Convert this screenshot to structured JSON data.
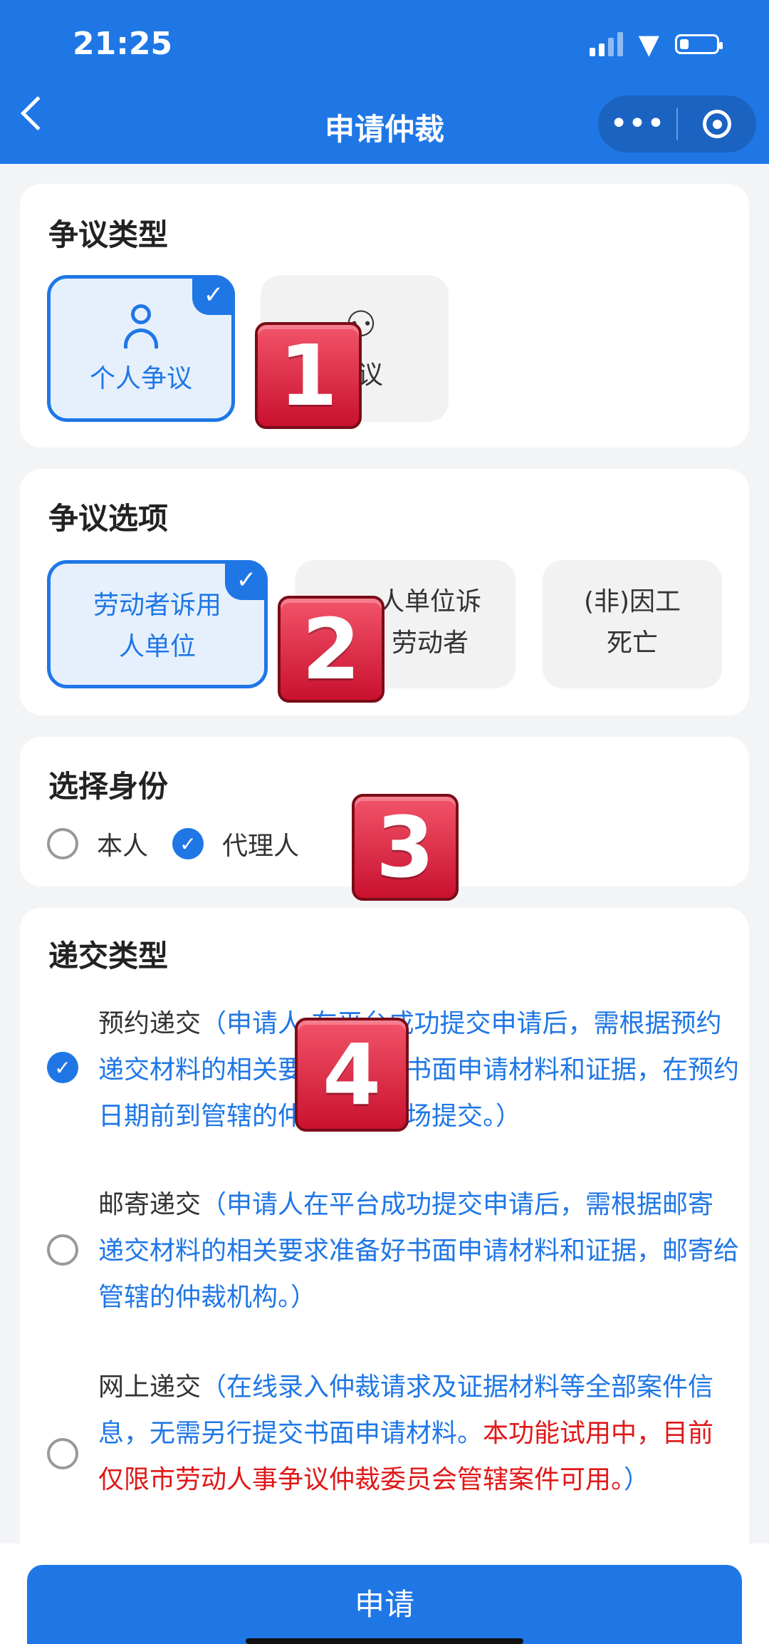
{
  "status_bar": {
    "time": "21:25"
  },
  "nav": {
    "title": "申请仲裁"
  },
  "dispute_type": {
    "title": "争议类型",
    "options": [
      {
        "label": "个人争议",
        "selected": true
      },
      {
        "label": "争议",
        "selected": false
      }
    ]
  },
  "dispute_option": {
    "title": "争议选项",
    "options": [
      {
        "line1": "劳动者诉用",
        "line2": "人单位",
        "selected": true
      },
      {
        "line1": "人单位诉",
        "line2": "劳动者",
        "selected": false
      },
      {
        "line1": "(非)因工",
        "line2": "死亡",
        "selected": false
      }
    ]
  },
  "identity": {
    "title": "选择身份",
    "options": [
      {
        "label": "本人",
        "selected": false
      },
      {
        "label": "代理人",
        "selected": true
      }
    ]
  },
  "submit_type": {
    "title": "递交类型",
    "items": [
      {
        "label": "预约递交",
        "desc": "（申请人 在平台成功提交申请后，需根据预约递交材料的相关要求准备好书面申请材料和证据，在预约日期前到管辖的仲裁机构现场提交。）",
        "selected": true
      },
      {
        "label": "邮寄递交",
        "desc": "（申请人在平台成功提交申请后，需根据邮寄递交材料的相关要求准备好书面申请材料和证据，邮寄给管辖的仲裁机构。）",
        "selected": false
      },
      {
        "label": "网上递交",
        "desc": "（在线录入仲裁请求及证据材料等全部案件信息，无需另行提交书面申请材料。",
        "warn": "本功能试用中，目前仅限市劳动人事争议仲裁委员会管辖案件可用。",
        "desc_end": "）",
        "selected": false
      }
    ]
  },
  "badges": [
    "1",
    "2",
    "3",
    "4"
  ],
  "footer": {
    "apply_label": "申请"
  },
  "colors": {
    "primary": "#1f77e6",
    "warning": "#e01818",
    "badge": "#d92840"
  }
}
